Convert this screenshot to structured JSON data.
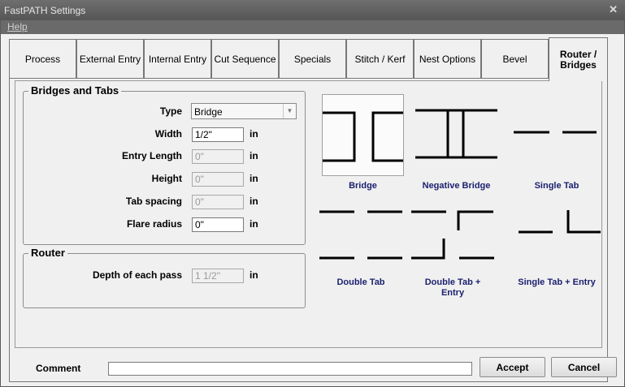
{
  "window": {
    "title": "FastPATH Settings",
    "close_glyph": "✕"
  },
  "menu": {
    "help": "Help"
  },
  "tabs": [
    {
      "label": "Process"
    },
    {
      "label": "External Entry"
    },
    {
      "label": "Internal Entry"
    },
    {
      "label": "Cut Sequence"
    },
    {
      "label": "Specials"
    },
    {
      "label": "Stitch / Kerf"
    },
    {
      "label": "Nest Options"
    },
    {
      "label": "Bevel"
    },
    {
      "label": "Router / Bridges",
      "line1": "Router /",
      "line2": "Bridges",
      "active": true
    }
  ],
  "bridges_group": {
    "title": "Bridges and Tabs",
    "type": {
      "label": "Type",
      "value": "Bridge"
    },
    "width": {
      "label": "Width",
      "value": "1/2\"",
      "unit": "in"
    },
    "entry_length": {
      "label": "Entry Length",
      "value": "0\"",
      "unit": "in"
    },
    "height": {
      "label": "Height",
      "value": "0\"",
      "unit": "in"
    },
    "tab_spacing": {
      "label": "Tab spacing",
      "value": "0\"",
      "unit": "in"
    },
    "flare_radius": {
      "label": "Flare radius",
      "value": "0\"",
      "unit": "in"
    }
  },
  "router_group": {
    "title": "Router",
    "depth": {
      "label": "Depth of each pass",
      "value": "1 1/2\"",
      "unit": "in"
    }
  },
  "bridge_options": [
    {
      "caption": "Bridge",
      "selected": true
    },
    {
      "caption": "Negative Bridge"
    },
    {
      "caption": "Single Tab"
    },
    {
      "caption": "Double Tab"
    },
    {
      "caption": "Double Tab + Entry",
      "line1": "Double Tab +",
      "line2": "Entry"
    },
    {
      "caption": "Single Tab + Entry"
    }
  ],
  "footer": {
    "comment_label": "Comment",
    "comment_value": "",
    "accept": "Accept",
    "cancel": "Cancel"
  },
  "colors": {
    "caption": "#1a1f6e",
    "titlebar": "#5e5e5e",
    "background": "#f0f0f0"
  }
}
